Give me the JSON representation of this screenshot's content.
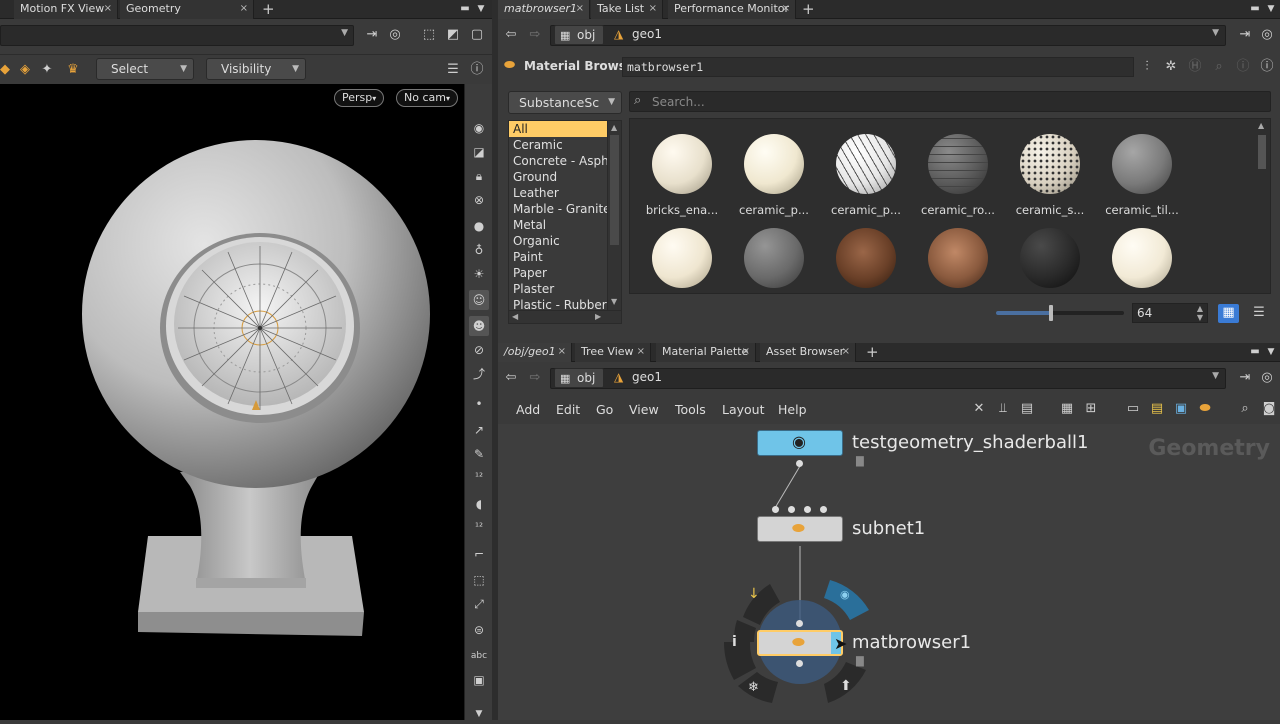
{
  "left_tabs": [
    {
      "label": "Motion FX View"
    },
    {
      "label": "Geometry Spreadsheet"
    }
  ],
  "scene_toolbar": {
    "select_label": "Select",
    "visibility_label": "Visibility"
  },
  "viewport": {
    "camera_mode": "Persp",
    "camera": "No cam"
  },
  "right_top_tabs": [
    {
      "label": "matbrowser1"
    },
    {
      "label": "Take List"
    },
    {
      "label": "Performance Monitor"
    }
  ],
  "top_path": {
    "root": "obj",
    "node": "geo1"
  },
  "material_browser": {
    "title": "Material Browser",
    "node_name": "matbrowser1",
    "source": "SubstanceSc",
    "search_placeholder": "Search...",
    "categories": [
      {
        "label": "All"
      },
      {
        "label": "Ceramic"
      },
      {
        "label": "Concrete - Asphalt"
      },
      {
        "label": "Ground"
      },
      {
        "label": "Leather"
      },
      {
        "label": "Marble - Granite"
      },
      {
        "label": "Metal"
      },
      {
        "label": "Organic"
      },
      {
        "label": "Paint"
      },
      {
        "label": "Paper"
      },
      {
        "label": "Plaster"
      },
      {
        "label": "Plastic - Rubber"
      }
    ],
    "materials": [
      {
        "label": "bricks_ena...",
        "color": "#e8e0cc"
      },
      {
        "label": "ceramic_p...",
        "color": "#f0e8d0"
      },
      {
        "label": "ceramic_p...",
        "color": "#e6e6e6"
      },
      {
        "label": "ceramic_ro...",
        "color": "#5a5a5a"
      },
      {
        "label": "ceramic_s...",
        "color": "#d8d0c0"
      },
      {
        "label": "ceramic_til...",
        "color": "#7a7a7a"
      },
      {
        "label": "",
        "color": "#efe6d0"
      },
      {
        "label": "",
        "color": "#6a6a6a"
      },
      {
        "label": "",
        "color": "#6a4028"
      },
      {
        "label": "",
        "color": "#8a5a3e"
      },
      {
        "label": "",
        "color": "#2a2a2a"
      },
      {
        "label": "",
        "color": "#f2ead6"
      }
    ],
    "thumb_size": "64"
  },
  "bottom_tabs": [
    {
      "label": "/obj/geo1"
    },
    {
      "label": "Tree View"
    },
    {
      "label": "Material Palette"
    },
    {
      "label": "Asset Browser"
    }
  ],
  "bottom_path": {
    "root": "obj",
    "node": "geo1"
  },
  "network_menu": [
    {
      "label": "Add"
    },
    {
      "label": "Edit"
    },
    {
      "label": "Go"
    },
    {
      "label": "View"
    },
    {
      "label": "Tools"
    },
    {
      "label": "Layout"
    },
    {
      "label": "Help"
    }
  ],
  "network": {
    "context_label": "Geometry",
    "nodes": [
      {
        "label": "testgeometry_shaderball1"
      },
      {
        "label": "subnet1"
      },
      {
        "label": "matbrowser1"
      }
    ]
  },
  "colors": {
    "accent_selected": "#ffcc66",
    "node_blue": "#6fc4e8",
    "node_gray": "#d4d4d4"
  }
}
